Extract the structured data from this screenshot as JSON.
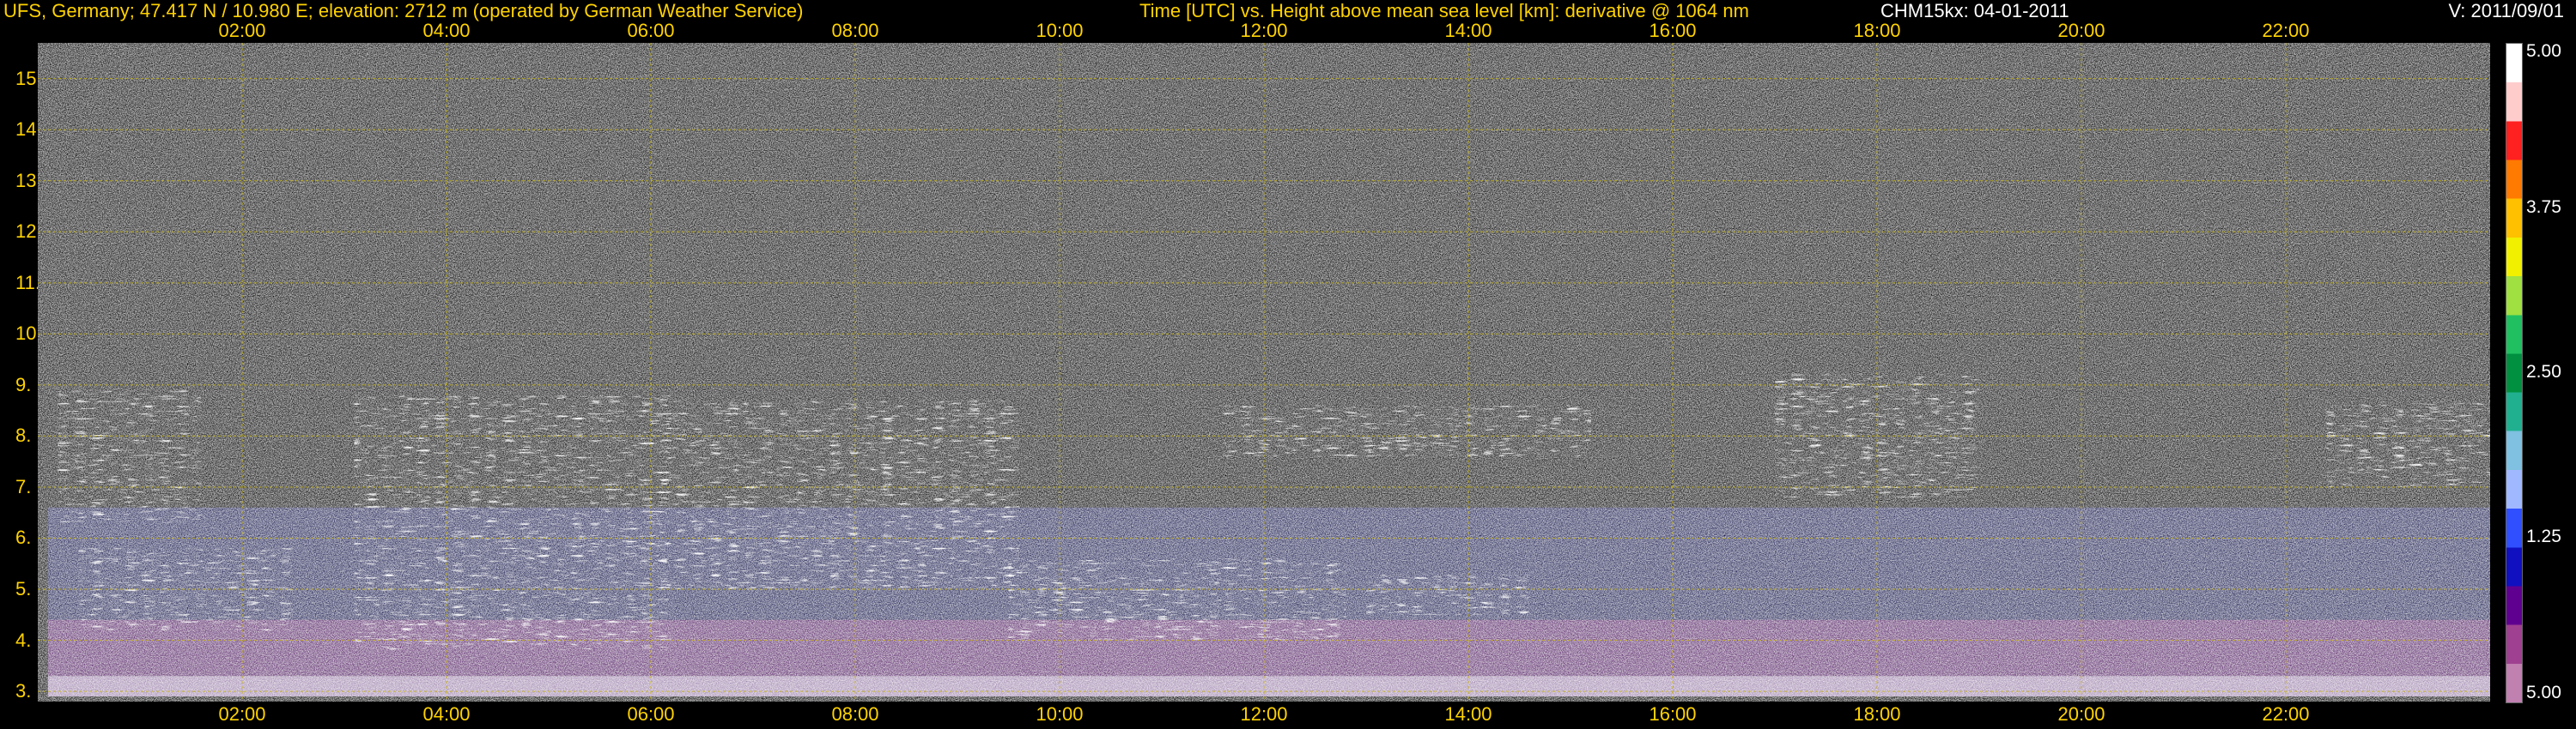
{
  "header": {
    "station": "UFS, Germany; 47.417 N / 10.980 E; elevation: 2712 m  (operated by German Weather Service)",
    "axes_description": "Time [UTC] vs. Height above mean sea level [km]: derivative @ 1064 nm",
    "instrument": "CHM15kx: 04-01-2011",
    "version": "V: 2011/09/01"
  },
  "chart_data": {
    "type": "heatmap",
    "x_ticks": [
      "02:00",
      "04:00",
      "06:00",
      "08:00",
      "10:00",
      "12:00",
      "14:00",
      "16:00",
      "18:00",
      "20:00",
      "22:00"
    ],
    "x_tick_hours": [
      2,
      4,
      6,
      8,
      10,
      12,
      14,
      16,
      18,
      20,
      22
    ],
    "xlim": [
      0,
      24
    ],
    "y_ticks": [
      "15.",
      "14.",
      "13.",
      "12.",
      "11.",
      "10.",
      "9.",
      "8.",
      "7.",
      "6.",
      "5.",
      "4.",
      "3."
    ],
    "y_tick_values": [
      15,
      14,
      13,
      12,
      11,
      10,
      9,
      8,
      7,
      6,
      5,
      4,
      3
    ],
    "ylim": [
      2.8,
      15.7
    ],
    "grid": true,
    "colorbar": {
      "labels": [
        "5.00",
        "3.75",
        "2.50",
        "1.25",
        "5.00"
      ],
      "label_fractions": [
        0,
        0.25,
        0.5,
        0.75,
        1
      ],
      "stops": [
        "#ffffff",
        "#ffcccc",
        "#ff2020",
        "#ff7a00",
        "#ffc000",
        "#f0f000",
        "#a0e040",
        "#20c060",
        "#009040",
        "#20b090",
        "#80c0e0",
        "#a0b8ff",
        "#3050ff",
        "#1010c0",
        "#600090",
        "#a04090",
        "#c080b0"
      ]
    },
    "layers": [
      {
        "hours": [
          0.1,
          24
        ],
        "heights": [
          2.9,
          3.3
        ],
        "color": "#b79ac9",
        "opacity": 0.85
      },
      {
        "hours": [
          0.1,
          24
        ],
        "heights": [
          3.3,
          4.4
        ],
        "color": "#6a2c80",
        "opacity": 0.8
      },
      {
        "hours": [
          0.1,
          24
        ],
        "heights": [
          4.4,
          6.6
        ],
        "color": "#2c2e8a",
        "opacity": 0.55
      }
    ],
    "cloud_regions": [
      {
        "hours": [
          0.2,
          1.6
        ],
        "heights": [
          6.3,
          8.9
        ]
      },
      {
        "hours": [
          0.4,
          2.5
        ],
        "heights": [
          4.2,
          5.8
        ]
      },
      {
        "hours": [
          3.1,
          6.2
        ],
        "heights": [
          3.8,
          8.8
        ]
      },
      {
        "hours": [
          6.0,
          9.6
        ],
        "heights": [
          5.0,
          8.7
        ]
      },
      {
        "hours": [
          9.5,
          12.8
        ],
        "heights": [
          4.0,
          5.6
        ]
      },
      {
        "hours": [
          11.6,
          15.2
        ],
        "heights": [
          7.6,
          8.6
        ]
      },
      {
        "hours": [
          13.0,
          14.6
        ],
        "heights": [
          4.5,
          5.3
        ]
      },
      {
        "hours": [
          17.0,
          19.0
        ],
        "heights": [
          6.8,
          9.2
        ]
      },
      {
        "hours": [
          22.4,
          24.0
        ],
        "heights": [
          7.0,
          8.7
        ]
      }
    ]
  }
}
